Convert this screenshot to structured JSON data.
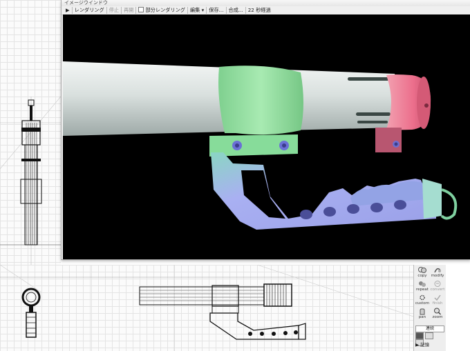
{
  "window": {
    "title": "イメージウインドウ"
  },
  "toolbar": {
    "play_icon": "play-icon",
    "render": "レンダリング",
    "stop": "停止",
    "restart": "再開",
    "partial_render": "部分レンダリング",
    "edit": "編集",
    "save": "保存...",
    "composite": "合成...",
    "elapsed_value": "22",
    "elapsed_label": "秒経過"
  },
  "palette": {
    "commands": [
      {
        "label": "copy",
        "icon": "copy-icon"
      },
      {
        "label": "modify",
        "icon": "modify-icon"
      },
      {
        "label": "repeat",
        "icon": "repeat-icon"
      },
      {
        "label": "convert",
        "icon": "convert-icon"
      },
      {
        "label": "custom",
        "icon": "custom-icon"
      },
      {
        "label": "finish",
        "icon": "finish-icon"
      },
      {
        "label": "pan",
        "icon": "pan-icon"
      },
      {
        "label": "zoom",
        "icon": "zoom-icon"
      }
    ],
    "mode": "連続",
    "memory": "記憶",
    "memory_arrow": "▶"
  },
  "colors": {
    "render_background": "#000000",
    "tube": "#d6dfdc",
    "clamp": "#98e3a6",
    "end_cap": "#ef7f9a",
    "rail": "#a4a9ee"
  }
}
